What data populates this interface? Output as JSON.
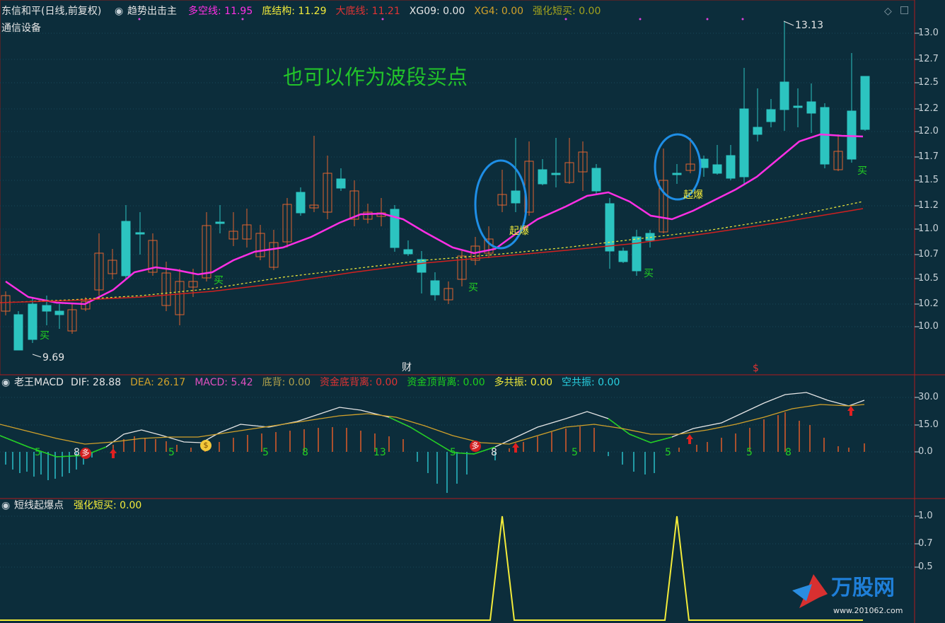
{
  "main": {
    "stock_name": "东信和平",
    "period": "(日线,前复权)",
    "indicator": "趋势出击主",
    "industry": "通信设备",
    "legend": [
      {
        "label": "多空线",
        "value": "11.95",
        "color": "#ff2fe5"
      },
      {
        "label": "底结构",
        "value": "11.29",
        "color": "#f3ec3a"
      },
      {
        "label": "大底线",
        "value": "11.21",
        "color": "#e13333"
      },
      {
        "label": "XG09",
        "value": "0.00",
        "color": "#e6e6e6"
      },
      {
        "label": "XG4",
        "value": "0.00",
        "color": "#d1a12a"
      },
      {
        "label": "强化短买",
        "value": "0.00",
        "color": "#a2a21d"
      }
    ],
    "annotation": "也可以作为波段买点",
    "high_label": "13.13",
    "low_label": "9.69",
    "marker_cai": "财",
    "marker_s": "$",
    "buy_label": "买",
    "boom_label": "起爆",
    "y_ticks": [
      "13.0",
      "12.7",
      "12.5",
      "12.2",
      "12.0",
      "11.7",
      "11.5",
      "11.2",
      "11.0",
      "10.7",
      "10.5",
      "10.2",
      "10.0"
    ],
    "colors": {
      "up": "#e0642f",
      "down": "#2cc4c0",
      "ma": "#ff2fe5",
      "dash": "#f3ec3a",
      "red": "#d02020",
      "circle": "#1e8ee6"
    }
  },
  "macd": {
    "name": "老王MACD",
    "legend": [
      {
        "label": "DIF",
        "value": "28.88",
        "color": "#e6e6e6"
      },
      {
        "label": "DEA",
        "value": "26.17",
        "color": "#d1a12a"
      },
      {
        "label": "MACD",
        "value": "5.42",
        "color": "#e050c0"
      },
      {
        "label": "底背",
        "value": "0.00",
        "color": "#b0a04a"
      },
      {
        "label": "资金底背离",
        "value": "0.00",
        "color": "#e13333"
      },
      {
        "label": "资金顶背离",
        "value": "0.00",
        "color": "#1dd11d"
      },
      {
        "label": "多共振",
        "value": "0.00",
        "color": "#f3ec3a"
      },
      {
        "label": "空共振",
        "value": "0.00",
        "color": "#28d0e0"
      }
    ],
    "y_ticks": [
      "30.0",
      "15.0",
      "0.0"
    ],
    "badge_duo": "多",
    "counts": [
      "5",
      "8",
      "5",
      "5",
      "8",
      "13",
      "5",
      "8",
      "5",
      "5",
      "5",
      "8"
    ]
  },
  "sub": {
    "name": "短线起爆点",
    "legend_label": "强化短买",
    "legend_value": "0.00",
    "y_ticks": [
      "1.0",
      "0.7",
      "0.5"
    ]
  },
  "watermark": {
    "brand": "万股网",
    "url": "www.201062.com"
  }
}
